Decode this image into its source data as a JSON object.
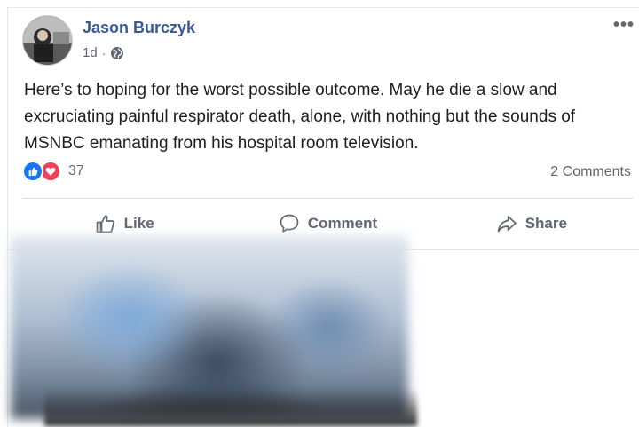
{
  "post": {
    "author": "Jason Burczyk",
    "time": "1d",
    "separator": "·",
    "privacy_icon": "globe-icon",
    "more_label": "•••",
    "text": "Here’s to hoping for the worst possible outcome. May he die a slow and excruciating painful respirator death, alone, with nothing but the sounds of MSNBC emanating from his hospital room television.",
    "reactions": {
      "icons": [
        "like-reaction-icon",
        "love-reaction-icon"
      ],
      "count": "37"
    },
    "comments_count": "2 Comments",
    "actions": {
      "like": "Like",
      "comment": "Comment",
      "share": "Share"
    }
  },
  "colors": {
    "author_link": "#385898",
    "meta_gray": "#606770",
    "like_blue": "#1877f2",
    "love_red": "#f33e58",
    "divider": "#dadde1"
  }
}
